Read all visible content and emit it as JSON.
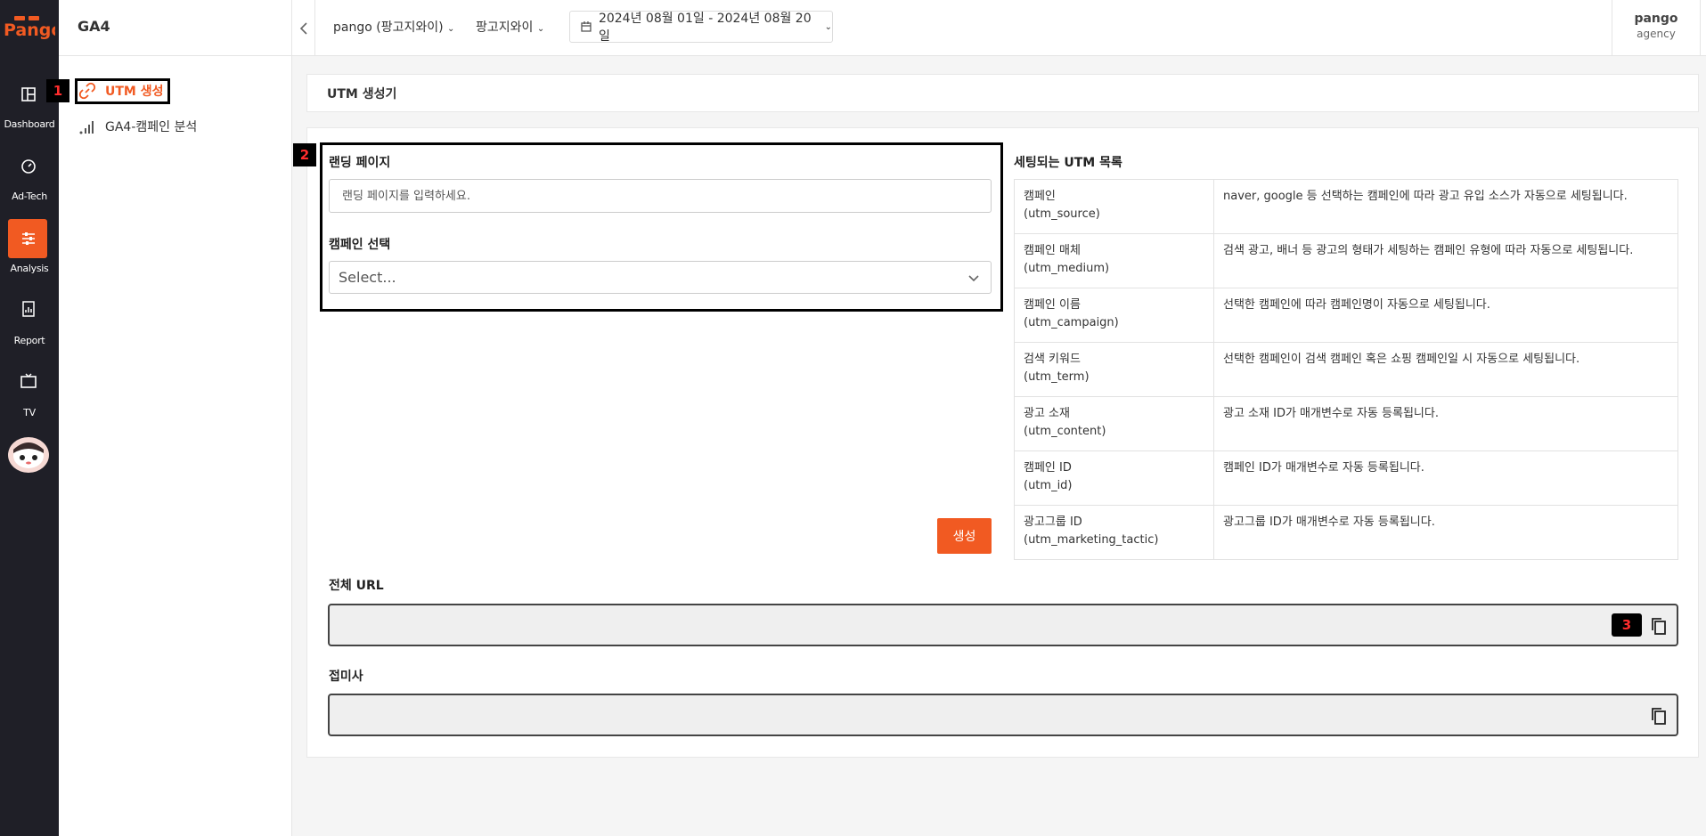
{
  "rail": {
    "logo_text": "Pango",
    "items": [
      {
        "label": "Dashboard",
        "icon": "dashboard-icon"
      },
      {
        "label": "Ad-Tech",
        "icon": "speedometer-icon"
      },
      {
        "label": "Analysis",
        "icon": "sliders-icon",
        "active": true
      },
      {
        "label": "Report",
        "icon": "report-chart-icon"
      },
      {
        "label": "TV",
        "icon": "tv-icon"
      }
    ]
  },
  "sidebar": {
    "title": "GA4",
    "items": [
      {
        "label": "UTM 생성",
        "icon": "link-icon",
        "active": true
      },
      {
        "label": "GA4-캠페인 분석",
        "icon": "signal-bars-icon"
      }
    ]
  },
  "topbar": {
    "account": "pango (팡고지와이)",
    "advertiser": "팡고지와이",
    "date_range": "2024년 08월 01일 - 2024년 08월 20일",
    "user_name": "pango",
    "user_org": "agency"
  },
  "page": {
    "title": "UTM 생성기"
  },
  "form": {
    "landing_label": "랜딩 페이지",
    "landing_placeholder": "랜딩 페이지를 입력하세요.",
    "campaign_label": "캠페인 선택",
    "campaign_value": "Select...",
    "generate_label": "생성"
  },
  "utm_list": {
    "title": "세팅되는 UTM 목록",
    "rows": [
      {
        "name": "캠페인",
        "param": "(utm_source)",
        "desc": "naver, google 등 선택하는 캠페인에 따라 광고 유입 소스가 자동으로 세팅됩니다."
      },
      {
        "name": "캠페인 매체",
        "param": "(utm_medium)",
        "desc": "검색 광고, 배너 등 광고의 형태가 세팅하는 캠페인 유형에 따라 자동으로 세팅됩니다."
      },
      {
        "name": "캠페인 이름",
        "param": "(utm_campaign)",
        "desc": "선택한 캠페인에 따라 캠페인명이 자동으로 세팅됩니다."
      },
      {
        "name": "검색 키워드",
        "param": "(utm_term)",
        "desc": "선택한 캠페인이 검색 캠페인 혹은 쇼핑 캠페인일 시 자동으로 세팅됩니다."
      },
      {
        "name": "광고 소재",
        "param": "(utm_content)",
        "desc": "광고 소재 ID가 매개변수로 자동 등록됩니다."
      },
      {
        "name": "캠페인 ID",
        "param": "(utm_id)",
        "desc": "캠페인 ID가 매개변수로 자동 등록됩니다."
      },
      {
        "name": "광고그룹 ID",
        "param": "(utm_marketing_tactic)",
        "desc": "광고그룹 ID가 매개변수로 자동 등록됩니다."
      }
    ]
  },
  "output": {
    "full_url_label": "전체 URL",
    "full_url_value": "",
    "suffix_label": "접미사",
    "suffix_value": ""
  },
  "annotations": {
    "badge1": "1",
    "badge2": "2",
    "badge3": "3"
  },
  "colors": {
    "accent": "#f15a22",
    "rail_bg": "#1f1f27"
  }
}
